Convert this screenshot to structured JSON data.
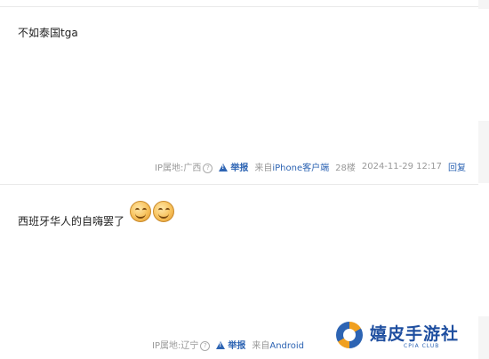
{
  "posts": [
    {
      "text": "不如泰国tga",
      "ip_label": "IP属地:广西",
      "report": "举报",
      "source_prefix": "来自",
      "source_device": "iPhone客户端",
      "floor": "28楼",
      "time": "2024-11-29 12:17",
      "reply": "回复"
    },
    {
      "text": "西班牙华人的自嗨罢了",
      "emoji": [
        "smiley-face",
        "smiley-face"
      ],
      "ip_label": "IP属地:辽宁",
      "report": "举报",
      "source_prefix": "来自",
      "source_device": "Android"
    }
  ],
  "watermark": {
    "title": "嬉皮手游社",
    "subtitle": "CPIA CLUB"
  },
  "colors": {
    "link": "#2d64b3",
    "meta": "#999999",
    "divider": "#e9e9e9"
  }
}
